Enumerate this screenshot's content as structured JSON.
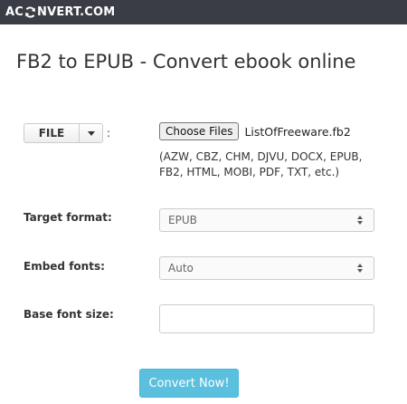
{
  "header": {
    "logo_prefix": "AC",
    "logo_suffix": "NVERT.COM"
  },
  "page": {
    "title": "FB2 to EPUB - Convert ebook online"
  },
  "file_source": {
    "button_label": "FILE",
    "colon": ":",
    "choose_label": "Choose Files",
    "chosen_file": "ListOfFreeware.fb2",
    "formats_note": "(AZW, CBZ, CHM, DJVU, DOCX, EPUB, FB2, HTML, MOBI, PDF, TXT, etc.)"
  },
  "options": {
    "target_format_label": "Target format:",
    "target_format_value": "EPUB",
    "embed_fonts_label": "Embed fonts:",
    "embed_fonts_value": "Auto",
    "base_font_size_label": "Base font size:",
    "base_font_size_value": ""
  },
  "actions": {
    "convert_label": "Convert Now!"
  },
  "colors": {
    "header_bg": "#3a3d45",
    "convert_button_bg": "#5bc0de"
  },
  "icons": {
    "logo_icon": "refresh-arrows-icon",
    "caret": "caret-down-icon",
    "select_arrows": "up-down-arrows-icon"
  }
}
